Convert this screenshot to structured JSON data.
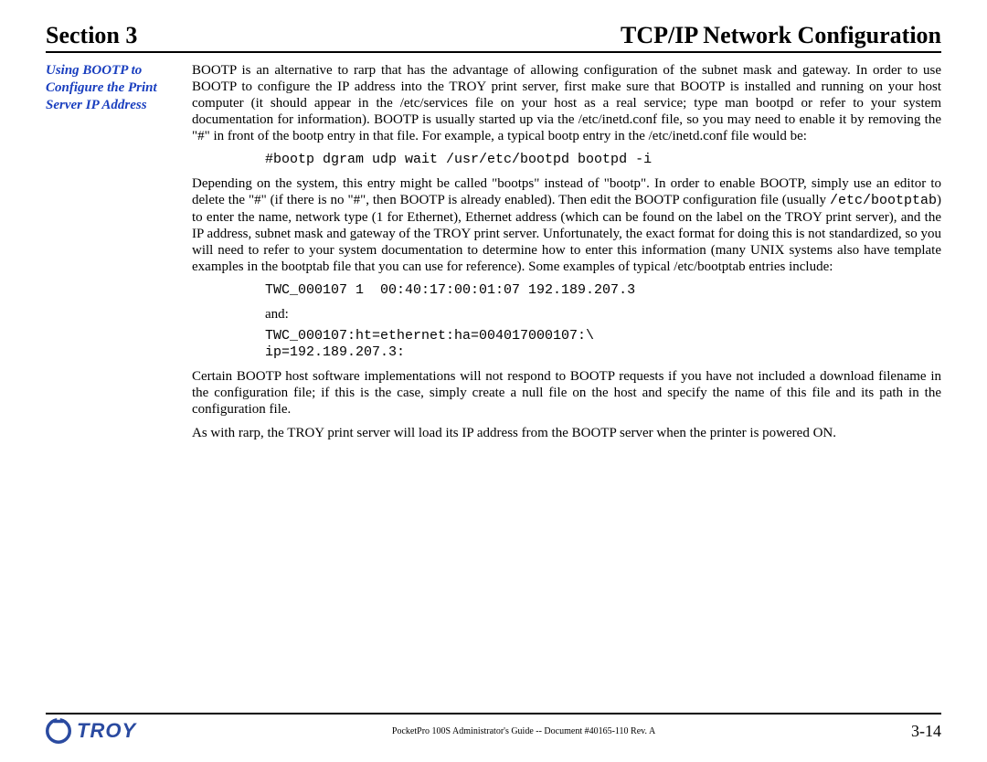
{
  "header": {
    "section_label": "Section 3",
    "title": "TCP/IP Network Configuration"
  },
  "sidebar": {
    "heading": "Using BOOTP to Configure the Print Server IP Address"
  },
  "content": {
    "p1": "BOOTP is an alternative to rarp that has the advantage of allowing configuration of the subnet mask and gateway.  In order to use BOOTP to configure the IP address into the TROY print server, first make sure that BOOTP is installed and running on your host computer (it should appear in the /etc/services file on your host as a real service; type man bootpd or refer to your system documentation for information).  BOOTP is usually started up via the /etc/inetd.conf file, so you may need to enable it by removing the \"#\" in front of the bootp entry in that file.  For example, a typical bootp entry in the /etc/inetd.conf file would be:",
    "code1": "#bootp dgram udp wait /usr/etc/bootpd bootpd -i",
    "p2a": "Depending on the system, this entry might be called \"bootps\" instead of \"bootp\".  In order to enable BOOTP, simply use an editor to delete the \"#\" (if there is no \"#\", then BOOTP is already enabled).  Then edit the BOOTP configuration file (usually ",
    "p2_mono": "/etc/bootptab",
    "p2b": ") to enter the name, network type (1 for Ethernet), Ethernet address (which can be found on the label on the TROY print server), and the IP address, subnet mask and gateway of the TROY print server.  Unfortunately, the exact format for doing this is not standardized, so you will need to refer to your system documentation to determine how to enter this information (many UNIX systems also have template examples in the bootptab file that you can use for reference).  Some examples of typical /etc/bootptab entries include:",
    "code2": "TWC_000107 1  00:40:17:00:01:07 192.189.207.3",
    "and_label": "and:",
    "code3": "TWC_000107:ht=ethernet:ha=004017000107:\\\nip=192.189.207.3:",
    "p3": "Certain BOOTP host software implementations will not respond to BOOTP requests if you have not included a download filename in the configuration file; if this is the case, simply create a null file on the host and specify the name of this file and its path in the configuration file.",
    "p4": "As with rarp, the TROY print server will load its IP address from the BOOTP server when the printer is powered ON."
  },
  "footer": {
    "brand": "TROY",
    "doc_id": "PocketPro 100S Administrator's Guide -- Document #40165-110  Rev. A",
    "page_number": "3-14"
  }
}
